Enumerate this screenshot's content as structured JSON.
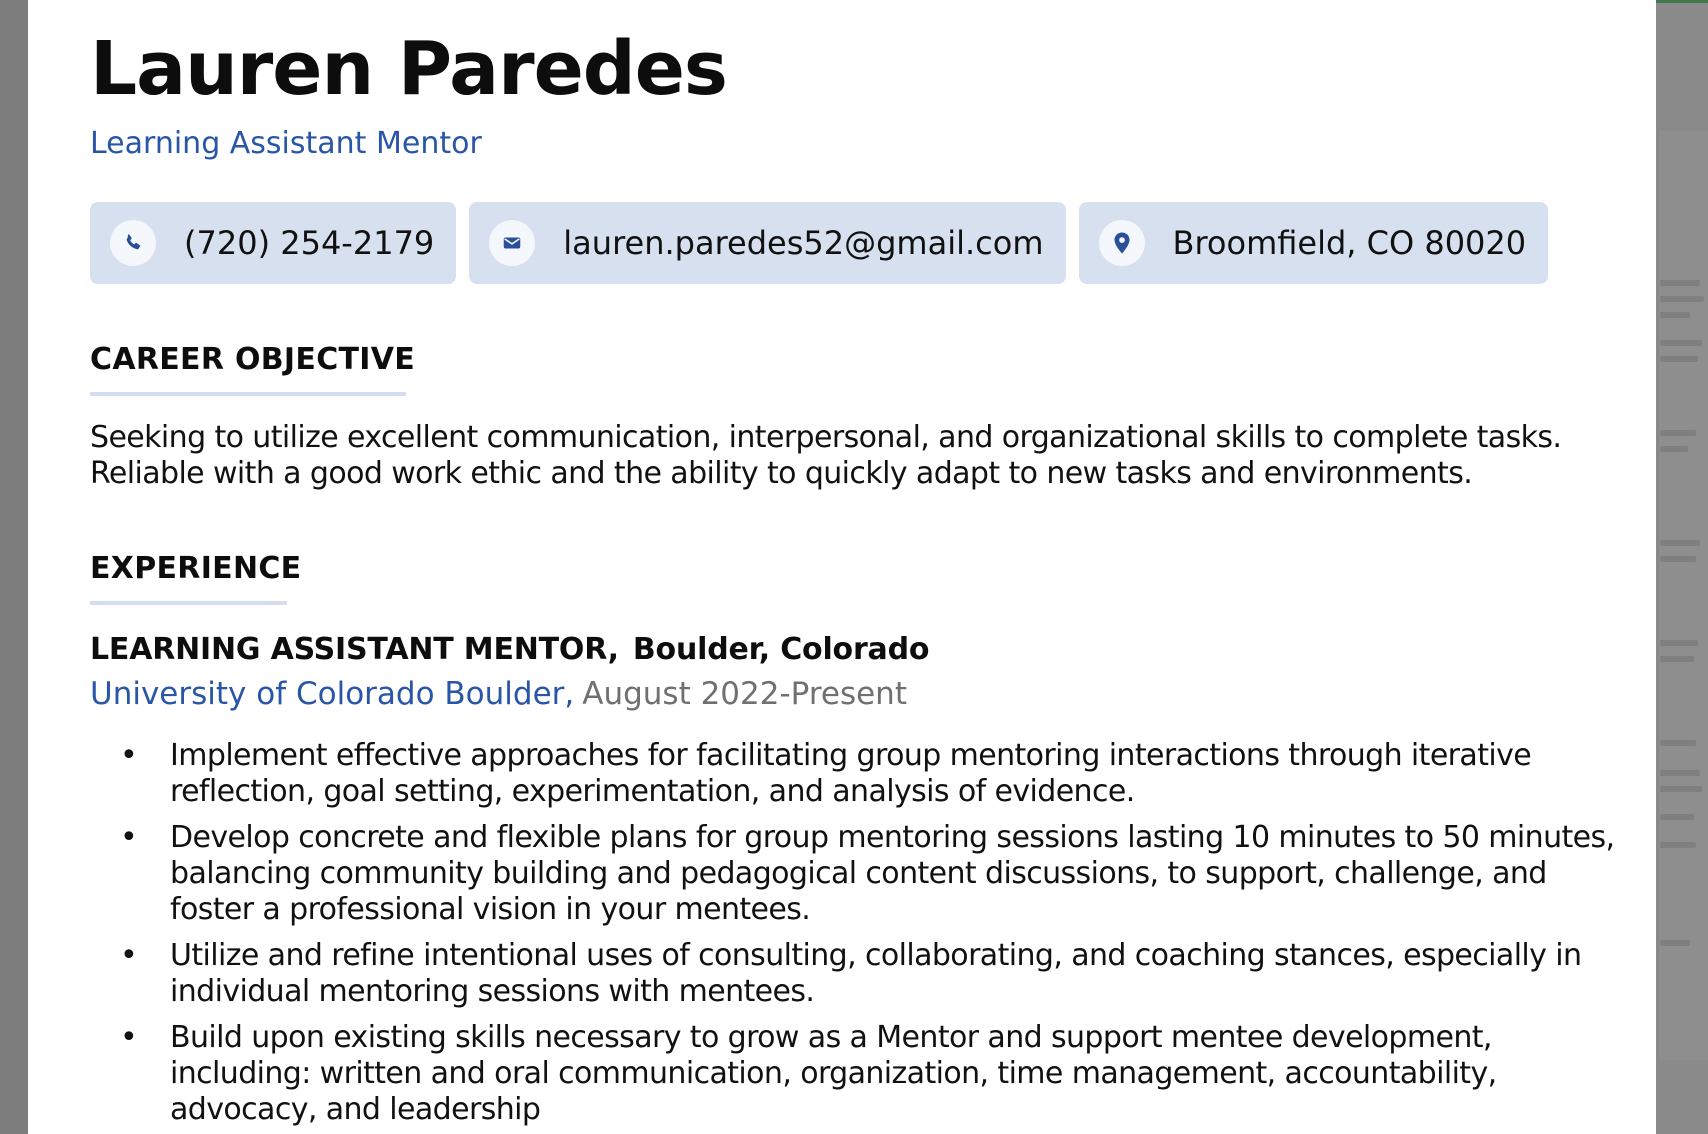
{
  "resume": {
    "name": "Lauren Paredes",
    "title": "Learning Assistant Mentor",
    "contacts": [
      {
        "icon": "phone-icon",
        "text": "(720) 254-2179"
      },
      {
        "icon": "email-icon",
        "text": "lauren.paredes52@gmail.com"
      },
      {
        "icon": "location-pin-icon",
        "text": "Broomfield, CO 80020"
      }
    ],
    "career_objective": {
      "heading": "CAREER OBJECTIVE",
      "text": "Seeking to utilize excellent communication, interpersonal, and organizational skills to complete tasks. Reliable with a good work ethic and the ability to quickly adapt to new tasks and environments."
    },
    "experience": {
      "heading": "EXPERIENCE",
      "job": {
        "role": "LEARNING ASSISTANT MENTOR,",
        "location": "Boulder, Colorado",
        "organization": "University of Colorado Boulder,",
        "dates": "August 2022-Present",
        "bullets": [
          "Implement effective approaches for facilitating group mentoring interactions through iterative reflection, goal setting, experimentation, and analysis of evidence.",
          "Develop concrete and flexible plans for group mentoring sessions lasting 10 minutes to 50 minutes, balancing community building and pedagogical content discussions, to support, challenge, and foster a professional vision in your mentees.",
          "Utilize and refine intentional uses of consulting, collaborating, and coaching stances, especially in individual mentoring sessions with mentees.",
          "Build upon existing skills necessary to grow as a Mentor and support mentee development, including: written and oral communication, organization, time management, accountability, advocacy, and leadership"
        ]
      }
    }
  },
  "colors": {
    "accent": "#2a56a8",
    "chip_bg": "#d6e0ef",
    "rule": "#d3ddee",
    "overlay": "#7d7d7d"
  }
}
